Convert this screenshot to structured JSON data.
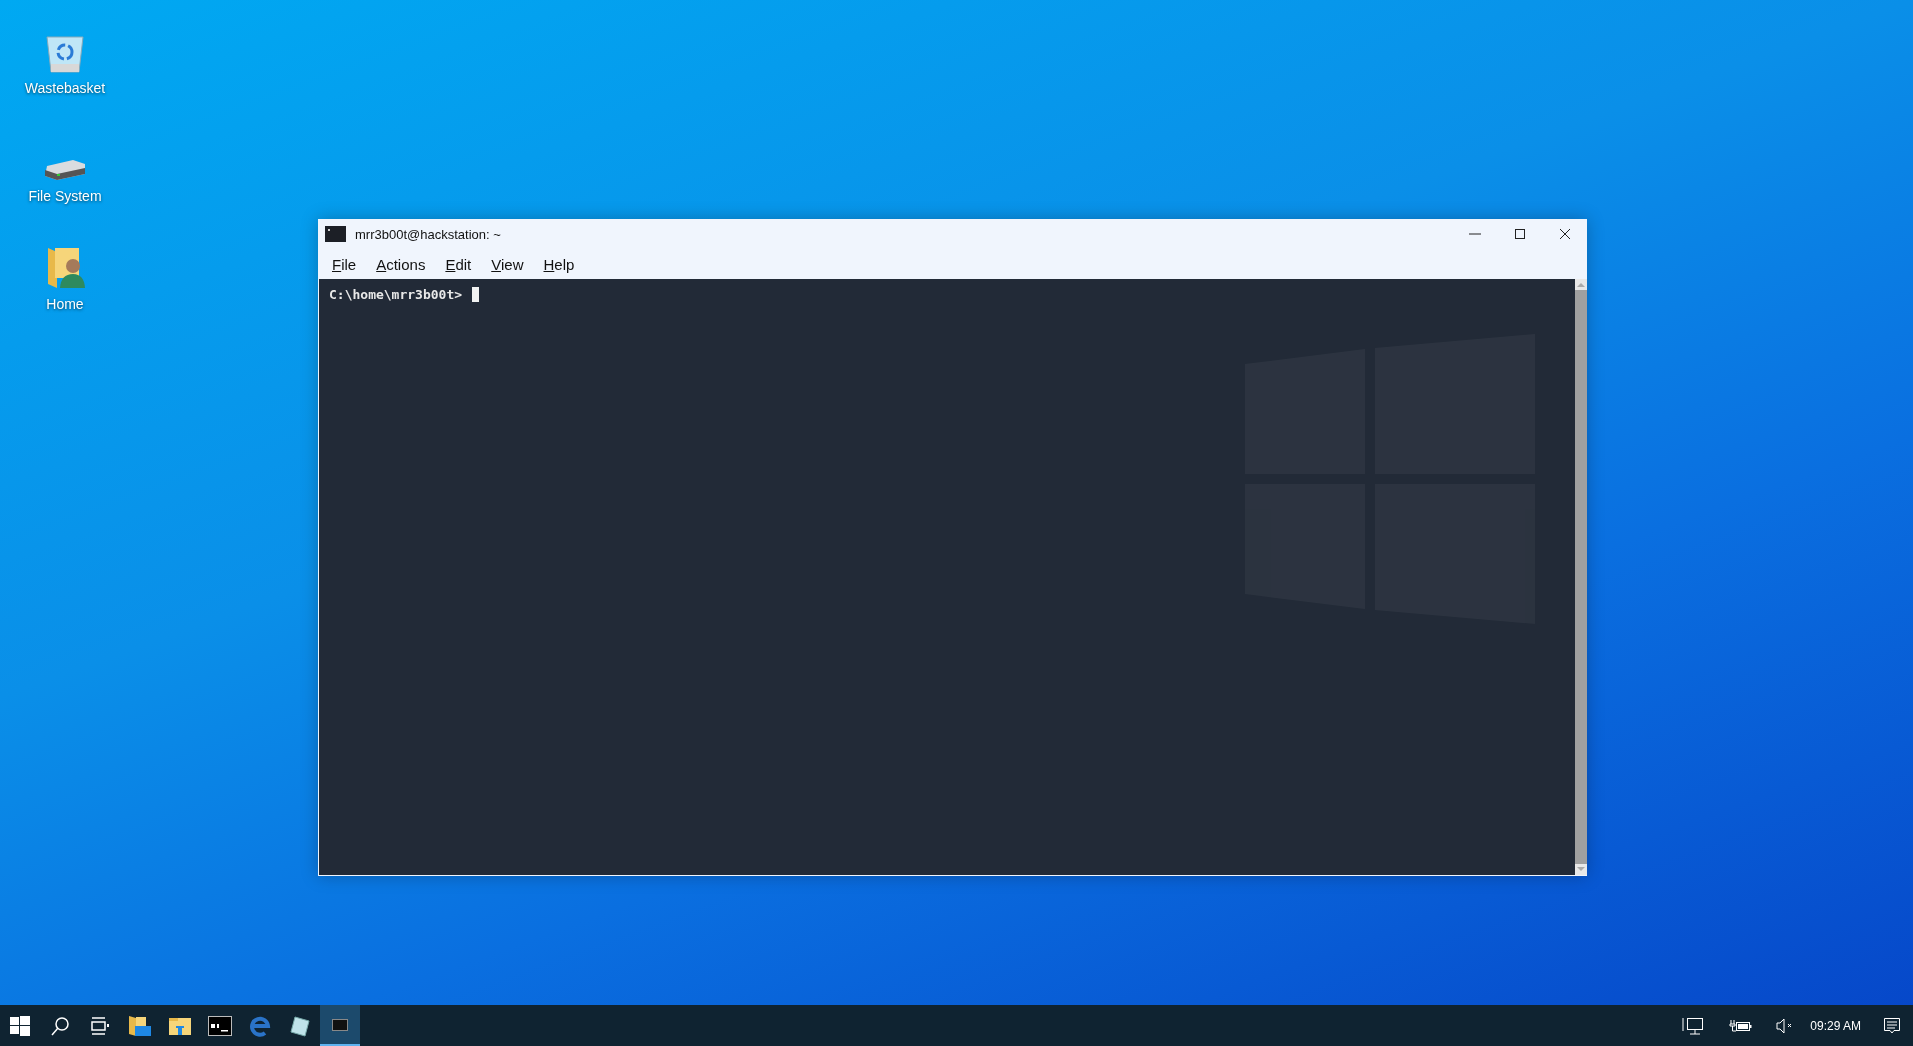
{
  "desktop_icons": [
    {
      "kind": "wastebasket",
      "label": "Wastebasket"
    },
    {
      "kind": "drive",
      "label": "File System"
    },
    {
      "kind": "home",
      "label": "Home"
    }
  ],
  "window": {
    "title": "mrr3b00t@hackstation: ~",
    "menu": [
      {
        "label": "File"
      },
      {
        "label": "Actions"
      },
      {
        "label": "Edit"
      },
      {
        "label": "View"
      },
      {
        "label": "Help"
      }
    ],
    "terminal": {
      "prompt": "C:\\home\\mrr3b00t>",
      "cursor": true
    }
  },
  "taskbar": {
    "apps": [
      {
        "kind": "files",
        "active": false
      },
      {
        "kind": "explorer",
        "active": false
      },
      {
        "kind": "console",
        "active": false
      },
      {
        "kind": "browser",
        "active": false
      },
      {
        "kind": "notepad",
        "active": false
      },
      {
        "kind": "terminal",
        "active": true
      }
    ],
    "clock": "09:29 AM"
  }
}
